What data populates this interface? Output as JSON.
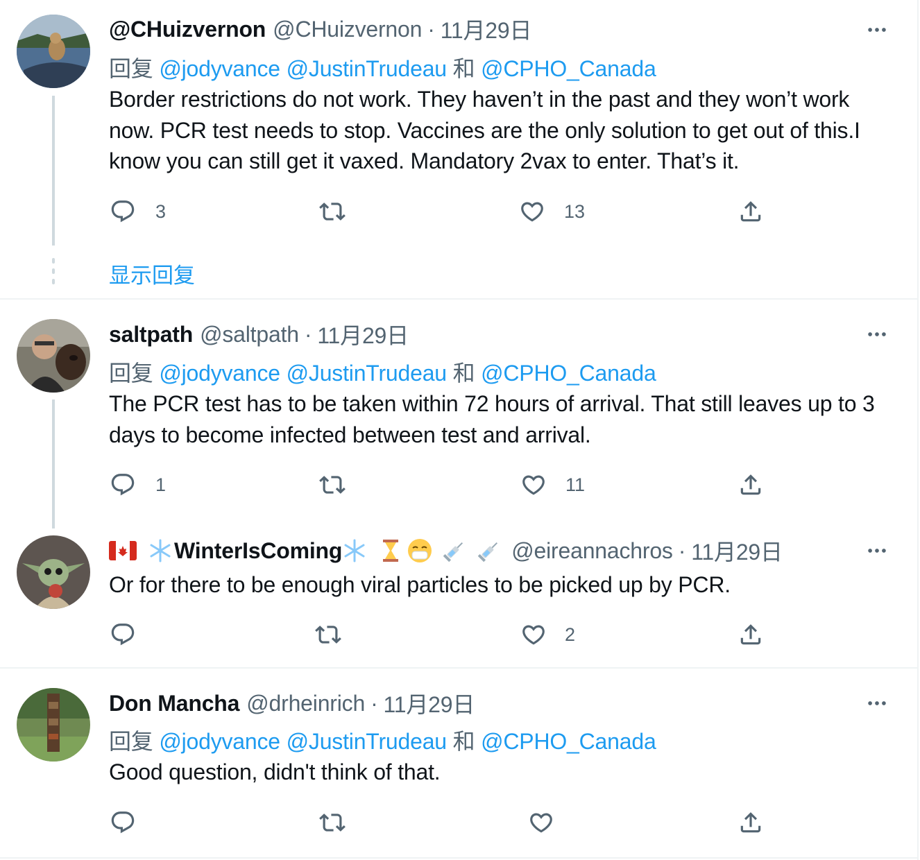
{
  "tweets": [
    {
      "name": "@CHuizvernon",
      "handle": "@CHuizvernon",
      "separator": "·",
      "date": "11月29日",
      "reply_prefix": "回复",
      "mention1": "@jodyvance",
      "mention2": "@JustinTrudeau",
      "conj": "和",
      "mention3": "@CPHO_Canada",
      "text": "Border restrictions do not work. They haven’t in the past and they won’t work now. PCR test needs to stop. Vaccines are the only solution to get out of this.I know you can still get it vaxed. Mandatory 2vax to enter. That’s it.",
      "replies": "3",
      "retweets": "",
      "likes": "13",
      "show_replies": "显示回复"
    },
    {
      "name": "saltpath",
      "handle": "@saltpath",
      "separator": "·",
      "date": "11月29日",
      "reply_prefix": "回复",
      "mention1": "@jodyvance",
      "mention2": "@JustinTrudeau",
      "conj": "和",
      "mention3": "@CPHO_Canada",
      "text": "The PCR test has to be taken within 72 hours of arrival. That still leaves up to 3 days to become infected between test and arrival.",
      "replies": "1",
      "retweets": "",
      "likes": "11"
    },
    {
      "name": "WinterIsComing",
      "handle": "@eireannachros",
      "separator": "·",
      "date": "11月29日",
      "text": "Or for there to be enough viral particles to be picked up by PCR.",
      "replies": "",
      "retweets": "",
      "likes": "2"
    },
    {
      "name": "Don Mancha",
      "handle": "@drheinrich",
      "separator": "·",
      "date": "11月29日",
      "reply_prefix": "回复",
      "mention1": "@jodyvance",
      "mention2": "@JustinTrudeau",
      "conj": "和",
      "mention3": "@CPHO_Canada",
      "text": "Good question, didn't think of that.",
      "replies": "",
      "retweets": "",
      "likes": ""
    }
  ],
  "colors": {
    "accent": "#1d9bf0",
    "secondary_text": "#536471",
    "primary_text": "#0f1419",
    "thread_line": "#cfd9de",
    "divider": "#eff3f4"
  },
  "icons": {
    "reply": "reply-icon",
    "retweet": "retweet-icon",
    "like": "heart-icon",
    "share": "share-icon",
    "more": "more-icon"
  }
}
